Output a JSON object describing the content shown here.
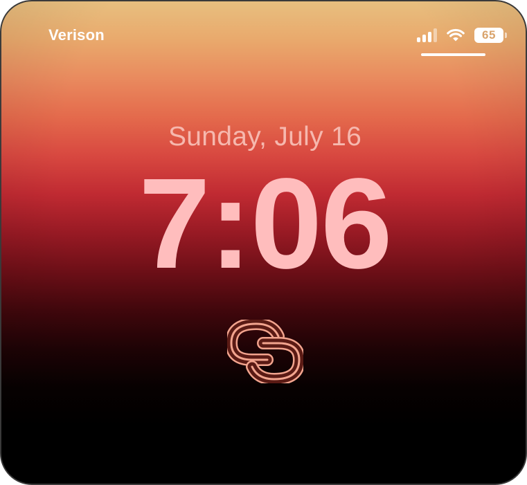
{
  "status_bar": {
    "carrier": "Verison",
    "signal_strength_bars": 3,
    "signal_total_bars": 4,
    "wifi_icon": "wifi-icon",
    "battery_level": "65"
  },
  "lock_screen": {
    "date": "Sunday, July 16",
    "time": "7:06",
    "widget_icon": "linked-chain-logo-icon"
  },
  "colors": {
    "date_text": "#f6b8ae",
    "time_text": "#ffbdbd",
    "logo_fill": "#5a1a14",
    "logo_stroke": "#f2a48e",
    "gradient_top": "#e8bf7f",
    "gradient_middle": "#c02a32",
    "gradient_bottom": "#000000"
  }
}
